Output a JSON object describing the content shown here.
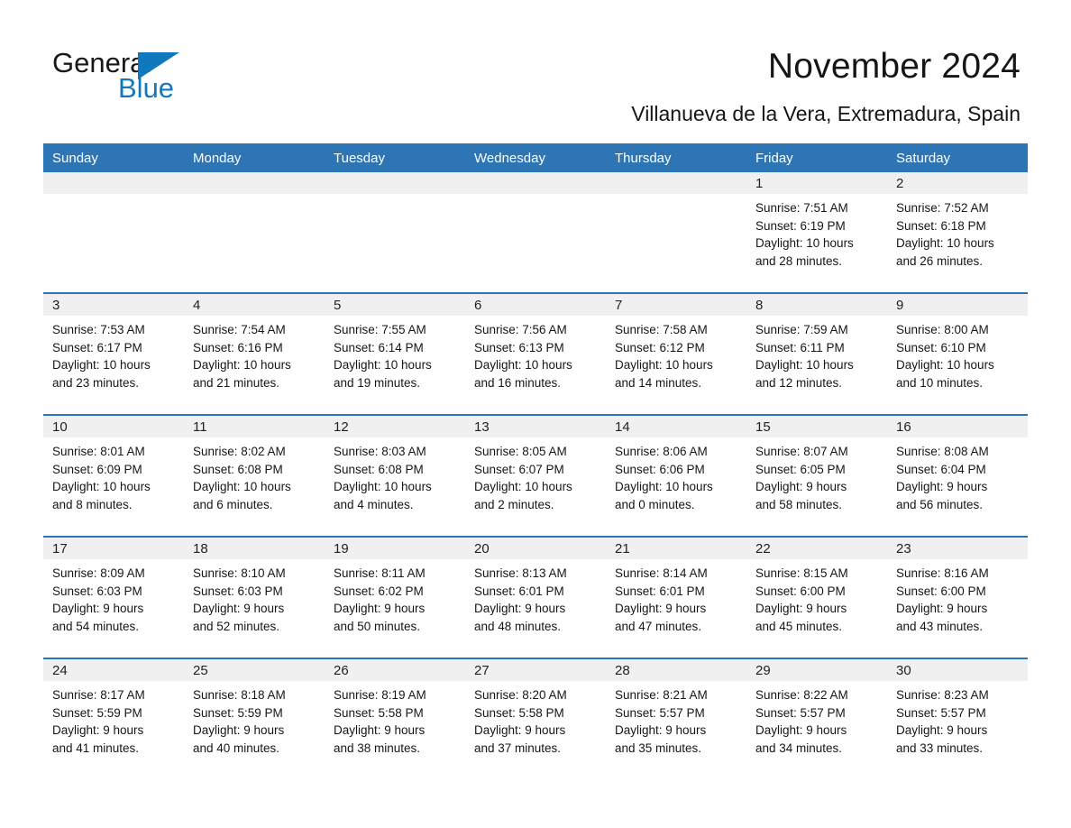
{
  "brand": {
    "name_part1": "General",
    "name_part2": "Blue",
    "accent_color": "#1278be",
    "triangle_icon": "triangle-icon"
  },
  "header": {
    "title": "November 2024",
    "location": "Villanueva de la Vera, Extremadura, Spain"
  },
  "theme": {
    "header_blue": "#2e75b6",
    "daynum_strip": "#f0f0f0",
    "text": "#161616"
  },
  "calendar": {
    "weekday_headers": [
      "Sunday",
      "Monday",
      "Tuesday",
      "Wednesday",
      "Thursday",
      "Friday",
      "Saturday"
    ],
    "weeks": [
      [
        {
          "empty": true
        },
        {
          "empty": true
        },
        {
          "empty": true
        },
        {
          "empty": true
        },
        {
          "empty": true
        },
        {
          "day": "1",
          "sunrise": "Sunrise: 7:51 AM",
          "sunset": "Sunset: 6:19 PM",
          "daylight_line1": "Daylight: 10 hours",
          "daylight_line2": "and 28 minutes."
        },
        {
          "day": "2",
          "sunrise": "Sunrise: 7:52 AM",
          "sunset": "Sunset: 6:18 PM",
          "daylight_line1": "Daylight: 10 hours",
          "daylight_line2": "and 26 minutes."
        }
      ],
      [
        {
          "day": "3",
          "sunrise": "Sunrise: 7:53 AM",
          "sunset": "Sunset: 6:17 PM",
          "daylight_line1": "Daylight: 10 hours",
          "daylight_line2": "and 23 minutes."
        },
        {
          "day": "4",
          "sunrise": "Sunrise: 7:54 AM",
          "sunset": "Sunset: 6:16 PM",
          "daylight_line1": "Daylight: 10 hours",
          "daylight_line2": "and 21 minutes."
        },
        {
          "day": "5",
          "sunrise": "Sunrise: 7:55 AM",
          "sunset": "Sunset: 6:14 PM",
          "daylight_line1": "Daylight: 10 hours",
          "daylight_line2": "and 19 minutes."
        },
        {
          "day": "6",
          "sunrise": "Sunrise: 7:56 AM",
          "sunset": "Sunset: 6:13 PM",
          "daylight_line1": "Daylight: 10 hours",
          "daylight_line2": "and 16 minutes."
        },
        {
          "day": "7",
          "sunrise": "Sunrise: 7:58 AM",
          "sunset": "Sunset: 6:12 PM",
          "daylight_line1": "Daylight: 10 hours",
          "daylight_line2": "and 14 minutes."
        },
        {
          "day": "8",
          "sunrise": "Sunrise: 7:59 AM",
          "sunset": "Sunset: 6:11 PM",
          "daylight_line1": "Daylight: 10 hours",
          "daylight_line2": "and 12 minutes."
        },
        {
          "day": "9",
          "sunrise": "Sunrise: 8:00 AM",
          "sunset": "Sunset: 6:10 PM",
          "daylight_line1": "Daylight: 10 hours",
          "daylight_line2": "and 10 minutes."
        }
      ],
      [
        {
          "day": "10",
          "sunrise": "Sunrise: 8:01 AM",
          "sunset": "Sunset: 6:09 PM",
          "daylight_line1": "Daylight: 10 hours",
          "daylight_line2": "and 8 minutes."
        },
        {
          "day": "11",
          "sunrise": "Sunrise: 8:02 AM",
          "sunset": "Sunset: 6:08 PM",
          "daylight_line1": "Daylight: 10 hours",
          "daylight_line2": "and 6 minutes."
        },
        {
          "day": "12",
          "sunrise": "Sunrise: 8:03 AM",
          "sunset": "Sunset: 6:08 PM",
          "daylight_line1": "Daylight: 10 hours",
          "daylight_line2": "and 4 minutes."
        },
        {
          "day": "13",
          "sunrise": "Sunrise: 8:05 AM",
          "sunset": "Sunset: 6:07 PM",
          "daylight_line1": "Daylight: 10 hours",
          "daylight_line2": "and 2 minutes."
        },
        {
          "day": "14",
          "sunrise": "Sunrise: 8:06 AM",
          "sunset": "Sunset: 6:06 PM",
          "daylight_line1": "Daylight: 10 hours",
          "daylight_line2": "and 0 minutes."
        },
        {
          "day": "15",
          "sunrise": "Sunrise: 8:07 AM",
          "sunset": "Sunset: 6:05 PM",
          "daylight_line1": "Daylight: 9 hours",
          "daylight_line2": "and 58 minutes."
        },
        {
          "day": "16",
          "sunrise": "Sunrise: 8:08 AM",
          "sunset": "Sunset: 6:04 PM",
          "daylight_line1": "Daylight: 9 hours",
          "daylight_line2": "and 56 minutes."
        }
      ],
      [
        {
          "day": "17",
          "sunrise": "Sunrise: 8:09 AM",
          "sunset": "Sunset: 6:03 PM",
          "daylight_line1": "Daylight: 9 hours",
          "daylight_line2": "and 54 minutes."
        },
        {
          "day": "18",
          "sunrise": "Sunrise: 8:10 AM",
          "sunset": "Sunset: 6:03 PM",
          "daylight_line1": "Daylight: 9 hours",
          "daylight_line2": "and 52 minutes."
        },
        {
          "day": "19",
          "sunrise": "Sunrise: 8:11 AM",
          "sunset": "Sunset: 6:02 PM",
          "daylight_line1": "Daylight: 9 hours",
          "daylight_line2": "and 50 minutes."
        },
        {
          "day": "20",
          "sunrise": "Sunrise: 8:13 AM",
          "sunset": "Sunset: 6:01 PM",
          "daylight_line1": "Daylight: 9 hours",
          "daylight_line2": "and 48 minutes."
        },
        {
          "day": "21",
          "sunrise": "Sunrise: 8:14 AM",
          "sunset": "Sunset: 6:01 PM",
          "daylight_line1": "Daylight: 9 hours",
          "daylight_line2": "and 47 minutes."
        },
        {
          "day": "22",
          "sunrise": "Sunrise: 8:15 AM",
          "sunset": "Sunset: 6:00 PM",
          "daylight_line1": "Daylight: 9 hours",
          "daylight_line2": "and 45 minutes."
        },
        {
          "day": "23",
          "sunrise": "Sunrise: 8:16 AM",
          "sunset": "Sunset: 6:00 PM",
          "daylight_line1": "Daylight: 9 hours",
          "daylight_line2": "and 43 minutes."
        }
      ],
      [
        {
          "day": "24",
          "sunrise": "Sunrise: 8:17 AM",
          "sunset": "Sunset: 5:59 PM",
          "daylight_line1": "Daylight: 9 hours",
          "daylight_line2": "and 41 minutes."
        },
        {
          "day": "25",
          "sunrise": "Sunrise: 8:18 AM",
          "sunset": "Sunset: 5:59 PM",
          "daylight_line1": "Daylight: 9 hours",
          "daylight_line2": "and 40 minutes."
        },
        {
          "day": "26",
          "sunrise": "Sunrise: 8:19 AM",
          "sunset": "Sunset: 5:58 PM",
          "daylight_line1": "Daylight: 9 hours",
          "daylight_line2": "and 38 minutes."
        },
        {
          "day": "27",
          "sunrise": "Sunrise: 8:20 AM",
          "sunset": "Sunset: 5:58 PM",
          "daylight_line1": "Daylight: 9 hours",
          "daylight_line2": "and 37 minutes."
        },
        {
          "day": "28",
          "sunrise": "Sunrise: 8:21 AM",
          "sunset": "Sunset: 5:57 PM",
          "daylight_line1": "Daylight: 9 hours",
          "daylight_line2": "and 35 minutes."
        },
        {
          "day": "29",
          "sunrise": "Sunrise: 8:22 AM",
          "sunset": "Sunset: 5:57 PM",
          "daylight_line1": "Daylight: 9 hours",
          "daylight_line2": "and 34 minutes."
        },
        {
          "day": "30",
          "sunrise": "Sunrise: 8:23 AM",
          "sunset": "Sunset: 5:57 PM",
          "daylight_line1": "Daylight: 9 hours",
          "daylight_line2": "and 33 minutes."
        }
      ]
    ]
  }
}
